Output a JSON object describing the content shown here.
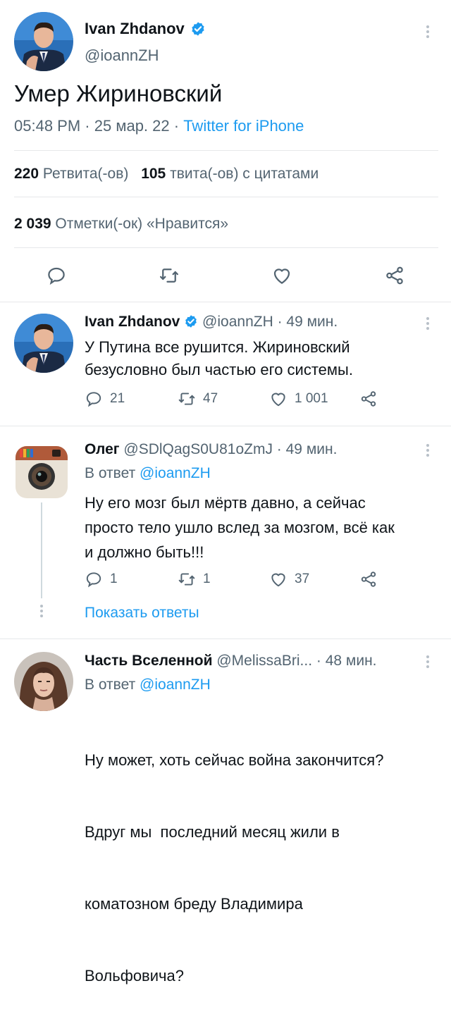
{
  "main_tweet": {
    "author_name": "Ivan Zhdanov",
    "handle": "@ioannZH",
    "text": "Умер Жириновский",
    "time": "05:48 PM",
    "date": "25 мар. 22",
    "source": "Twitter for iPhone",
    "separator": "·",
    "retweets_count": "220",
    "retweets_label": "Ретвита(-ов)",
    "quotes_count": "105",
    "quotes_label": "твита(-ов) с цитатами",
    "likes_count": "2 039",
    "likes_label": "Отметки(-ок) «Нравится»"
  },
  "replies": [
    {
      "author_name": "Ivan Zhdanov",
      "handle": "@ioannZH",
      "time": "· 49 мин.",
      "lines": [
        "У Путина все рушится. Жириновский",
        "безусловно был частью его системы."
      ],
      "reply_count": "21",
      "retweet_count": "47",
      "like_count": "1 001"
    },
    {
      "author_name": "Олег",
      "handle": "@SDlQagS0U81oZmJ",
      "time": "· 49 мин.",
      "reply_prefix": "В ответ",
      "reply_to": "@ioannZH",
      "lines": [
        "Ну его мозг был мёртв давно, а сейчас",
        "просто тело ушло вслед за мозгом, всё как",
        "и должно быть!!!"
      ],
      "reply_count": "1",
      "retweet_count": "1",
      "like_count": "37",
      "show_replies": "Показать ответы"
    },
    {
      "author_name": "Часть Вселенной",
      "handle": "@MelissaBri...",
      "time": "· 48 мин.",
      "reply_prefix": "В ответ",
      "reply_to": "@ioannZH",
      "lines": [
        "Ну может, хоть сейчас война закончится?",
        "Вдруг мы  последний месяц жили в",
        "коматозном бреду Владимира",
        "Вольфовича?"
      ]
    }
  ],
  "colors": {
    "accent": "#1d9bf0",
    "text": "#0f1419",
    "secondary": "#536471",
    "divider": "#e6e8ea"
  },
  "icons": [
    "verified-badge-icon",
    "more-options-icon",
    "reply-icon",
    "retweet-icon",
    "like-icon",
    "share-icon",
    "instagram-logo-icon"
  ]
}
